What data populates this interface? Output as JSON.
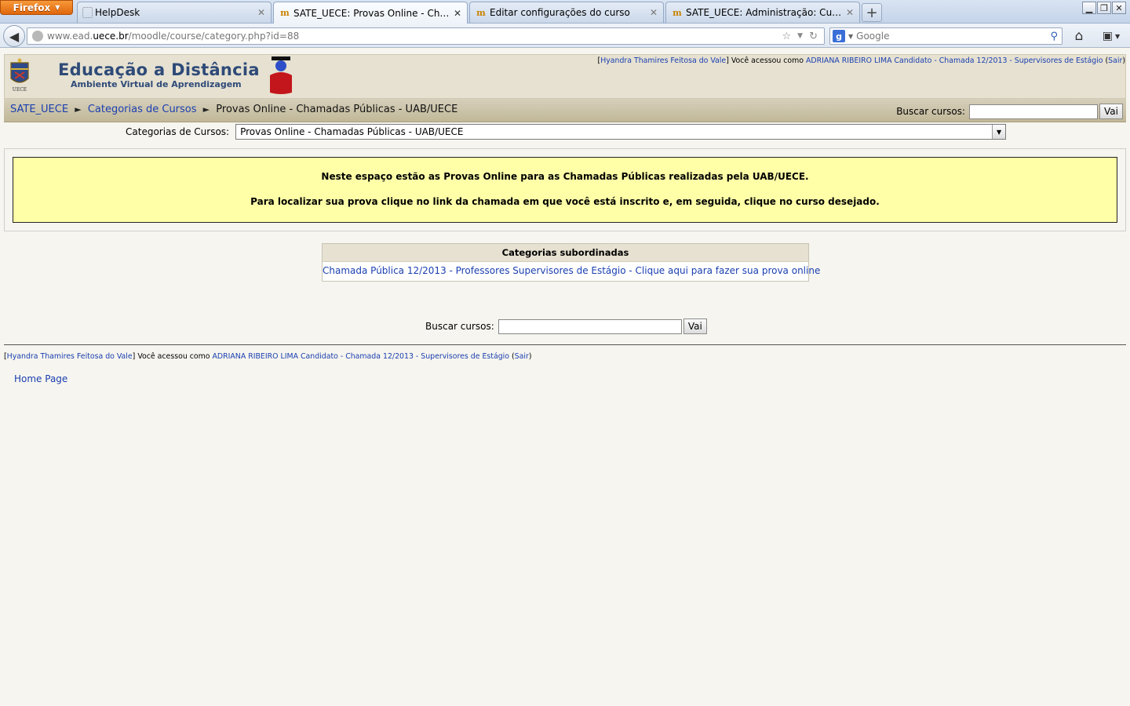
{
  "browser": {
    "menu_button": "Firefox",
    "tabs": [
      {
        "title": "HelpDesk",
        "icon": "blank-page-icon",
        "active": false
      },
      {
        "title": "SATE_UECE: Provas Online - Chamad...",
        "icon": "moodle-icon",
        "active": true
      },
      {
        "title": "Editar configurações do curso",
        "icon": "moodle-icon",
        "active": false
      },
      {
        "title": "SATE_UECE: Administração: Cursos: ...",
        "icon": "moodle-icon",
        "active": false
      }
    ],
    "url_prefix": "www.ead.",
    "url_domain": "uece.br",
    "url_path": "/moodle/course/category.php?id=88",
    "search_placeholder": "Google"
  },
  "header": {
    "logo_title": "Educação a Distância",
    "logo_subtitle": "Ambiente Virtual de Aprendizagem",
    "crest_caption": "UECE",
    "login": {
      "real_user": "Hyandra Thamires Feitosa do Vale",
      "as_text": " Você acessou como ",
      "user": "ADRIANA RIBEIRO LIMA Candidato - Chamada 12/2013 - Supervisores de Estágio",
      "logout": "Sair"
    }
  },
  "navbar": {
    "breadcrumb": [
      "SATE_UECE",
      "Categorias de Cursos",
      "Provas Online - Chamadas Públicas - UAB/UECE"
    ],
    "separator": "►",
    "search_label": "Buscar cursos:",
    "search_button": "Vai"
  },
  "category_menu": {
    "label": "Categorias de Cursos:",
    "selected": "Provas Online - Chamadas Públicas - UAB/UECE"
  },
  "description": {
    "line1": "Neste espaço estão as Provas Online para as Chamadas Públicas realizadas pela UAB/UECE.",
    "line2": "Para localizar sua prova clique no link da chamada em que você está inscrito e, em seguida, clique no curso desejado."
  },
  "subcategories": {
    "heading": "Categorias subordinadas",
    "items": [
      "Chamada Pública 12/2013 - Professores Supervisores de Estágio - Clique aqui para fazer sua prova online"
    ]
  },
  "footer": {
    "search_label": "Buscar cursos:",
    "search_button": "Vai",
    "home_link": "Home Page"
  }
}
